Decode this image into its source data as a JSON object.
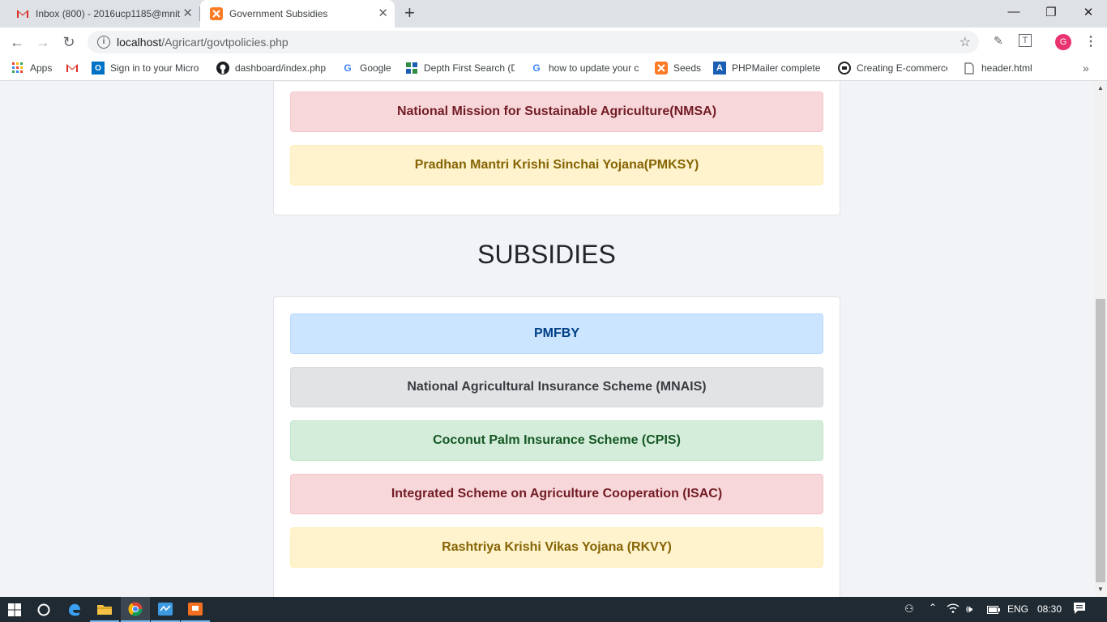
{
  "tabs": [
    {
      "title": "Inbox (800) - 2016ucp1185@mnit",
      "icon": "gmail-icon"
    },
    {
      "title": "Government Subsidies",
      "icon": "xampp-icon"
    }
  ],
  "window_controls": {
    "minimize": "—",
    "restore": "❐",
    "close": "✕"
  },
  "address_bar": {
    "host": "localhost",
    "path": "/Agricart/govtpolicies.php"
  },
  "profile_initial": "G",
  "bookmarks": [
    {
      "label": "Apps",
      "icon": "apps-grid-icon"
    },
    {
      "label": "",
      "icon": "gmail-icon"
    },
    {
      "label": "Sign in to your Micro",
      "icon": "outlook-icon"
    },
    {
      "label": "dashboard/index.php",
      "icon": "github-icon"
    },
    {
      "label": "Google",
      "icon": "google-icon"
    },
    {
      "label": "Depth First Search (D",
      "icon": "dfs-site-icon"
    },
    {
      "label": "how to update your c",
      "icon": "google-icon"
    },
    {
      "label": "Seeds",
      "icon": "xampp-icon"
    },
    {
      "label": "PHPMailer complete",
      "icon": "phpmailer-icon"
    },
    {
      "label": "Creating E-commerce",
      "icon": "ecommerce-site-icon"
    },
    {
      "label": "header.html",
      "icon": "file-icon"
    }
  ],
  "policies": [
    {
      "label": "National Mission for Sustainable Agriculture(NMSA)",
      "color": "#f8d7da"
    },
    {
      "label": "Pradhan Mantri Krishi Sinchai Yojana(PMKSY)",
      "color": "#fff3cd"
    }
  ],
  "subsidies_title": "SUBSIDIES",
  "subsidies": [
    {
      "label": "PMFBY",
      "color": "#cce5ff"
    },
    {
      "label": "National Agricultural Insurance Scheme (MNAIS)",
      "color": "#e2e3e5"
    },
    {
      "label": "Coconut Palm Insurance Scheme (CPIS)",
      "color": "#d4edda"
    },
    {
      "label": "Integrated Scheme on Agriculture Cooperation (ISAC)",
      "color": "#f8d7da"
    },
    {
      "label": "Rashtriya Krishi Vikas Yojana (RKVY)",
      "color": "#fff3cd"
    }
  ],
  "taskbar": {
    "language": "ENG",
    "time": "08:30",
    "apps": [
      "windows-start-icon",
      "cortana-icon",
      "edge-icon",
      "file-explorer-icon",
      "chrome-icon",
      "whiteboard-icon",
      "powerpoint-icon"
    ]
  }
}
